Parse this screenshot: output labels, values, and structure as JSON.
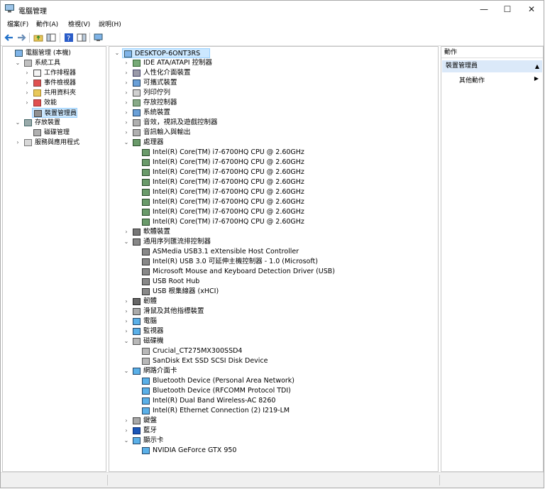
{
  "window": {
    "title": "電腦管理",
    "min": "—",
    "max": "☐",
    "close": "✕"
  },
  "menu": [
    "檔案(F)",
    "動作(A)",
    "檢視(V)",
    "說明(H)"
  ],
  "colors": {
    "selection": "#cce8ff",
    "action_section": "#dbe9f9"
  },
  "left_tree": [
    {
      "label": "電腦管理 (本機)",
      "level": 0,
      "expander": "",
      "icon": "computer-manage-icon"
    },
    {
      "label": "系統工具",
      "level": 1,
      "expander": "v",
      "icon": "tools-icon"
    },
    {
      "label": "工作排程器",
      "level": 2,
      "expander": ">",
      "icon": "clock-icon"
    },
    {
      "label": "事件檢視器",
      "level": 2,
      "expander": ">",
      "icon": "event-viewer-icon"
    },
    {
      "label": "共用資料夾",
      "level": 2,
      "expander": ">",
      "icon": "shared-folder-icon"
    },
    {
      "label": "效能",
      "level": 2,
      "expander": ">",
      "icon": "performance-icon"
    },
    {
      "label": "裝置管理員",
      "level": 2,
      "expander": "",
      "icon": "device-manager-icon",
      "selected": true
    },
    {
      "label": "存放裝置",
      "level": 1,
      "expander": "v",
      "icon": "storage-icon"
    },
    {
      "label": "磁碟管理",
      "level": 2,
      "expander": "",
      "icon": "disk-manage-icon"
    },
    {
      "label": "服務與應用程式",
      "level": 1,
      "expander": ">",
      "icon": "services-icon"
    }
  ],
  "device_tree": [
    {
      "label": "DESKTOP-6ONT3RS",
      "level": 0,
      "expander": "v",
      "icon": "computer-icon",
      "selected": true
    },
    {
      "label": "IDE ATA/ATAPI 控制器",
      "level": 1,
      "expander": ">",
      "icon": "ide-icon"
    },
    {
      "label": "人性化介面裝置",
      "level": 1,
      "expander": ">",
      "icon": "hid-icon"
    },
    {
      "label": "可攜式裝置",
      "level": 1,
      "expander": ">",
      "icon": "portable-icon"
    },
    {
      "label": "列印佇列",
      "level": 1,
      "expander": ">",
      "icon": "printer-icon"
    },
    {
      "label": "存放控制器",
      "level": 1,
      "expander": ">",
      "icon": "storage-controller-icon"
    },
    {
      "label": "系統裝置",
      "level": 1,
      "expander": ">",
      "icon": "system-device-icon"
    },
    {
      "label": "音效，視訊及遊戲控制器",
      "level": 1,
      "expander": ">",
      "icon": "sound-icon"
    },
    {
      "label": "音訊輸入與輸出",
      "level": 1,
      "expander": ">",
      "icon": "audio-io-icon"
    },
    {
      "label": "處理器",
      "level": 1,
      "expander": "v",
      "icon": "processor-icon"
    },
    {
      "label": "Intel(R) Core(TM) i7-6700HQ CPU @ 2.60GHz",
      "level": 2,
      "expander": "",
      "icon": "processor-icon"
    },
    {
      "label": "Intel(R) Core(TM) i7-6700HQ CPU @ 2.60GHz",
      "level": 2,
      "expander": "",
      "icon": "processor-icon"
    },
    {
      "label": "Intel(R) Core(TM) i7-6700HQ CPU @ 2.60GHz",
      "level": 2,
      "expander": "",
      "icon": "processor-icon"
    },
    {
      "label": "Intel(R) Core(TM) i7-6700HQ CPU @ 2.60GHz",
      "level": 2,
      "expander": "",
      "icon": "processor-icon"
    },
    {
      "label": "Intel(R) Core(TM) i7-6700HQ CPU @ 2.60GHz",
      "level": 2,
      "expander": "",
      "icon": "processor-icon"
    },
    {
      "label": "Intel(R) Core(TM) i7-6700HQ CPU @ 2.60GHz",
      "level": 2,
      "expander": "",
      "icon": "processor-icon"
    },
    {
      "label": "Intel(R) Core(TM) i7-6700HQ CPU @ 2.60GHz",
      "level": 2,
      "expander": "",
      "icon": "processor-icon"
    },
    {
      "label": "Intel(R) Core(TM) i7-6700HQ CPU @ 2.60GHz",
      "level": 2,
      "expander": "",
      "icon": "processor-icon"
    },
    {
      "label": "軟體裝置",
      "level": 1,
      "expander": ">",
      "icon": "software-device-icon"
    },
    {
      "label": "通用序列匯流排控制器",
      "level": 1,
      "expander": "v",
      "icon": "usb-icon"
    },
    {
      "label": "ASMedia USB3.1 eXtensible Host Controller",
      "level": 2,
      "expander": "",
      "icon": "usb-icon"
    },
    {
      "label": "Intel(R) USB 3.0 可延伸主機控制器 - 1.0 (Microsoft)",
      "level": 2,
      "expander": "",
      "icon": "usb-icon"
    },
    {
      "label": "Microsoft Mouse and Keyboard Detection Driver (USB)",
      "level": 2,
      "expander": "",
      "icon": "usb-icon"
    },
    {
      "label": "USB Root Hub",
      "level": 2,
      "expander": "",
      "icon": "usb-icon"
    },
    {
      "label": "USB 根集線器 (xHCI)",
      "level": 2,
      "expander": "",
      "icon": "usb-icon"
    },
    {
      "label": "韌體",
      "level": 1,
      "expander": ">",
      "icon": "firmware-icon"
    },
    {
      "label": "滑鼠及其他指標裝置",
      "level": 1,
      "expander": ">",
      "icon": "mouse-icon"
    },
    {
      "label": "電腦",
      "level": 1,
      "expander": ">",
      "icon": "monitor-icon"
    },
    {
      "label": "監視器",
      "level": 1,
      "expander": ">",
      "icon": "monitor-icon"
    },
    {
      "label": "磁碟機",
      "level": 1,
      "expander": "v",
      "icon": "disk-drive-icon"
    },
    {
      "label": "Crucial_CT275MX300SSD4",
      "level": 2,
      "expander": "",
      "icon": "disk-drive-icon"
    },
    {
      "label": "SanDisk Ext SSD SCSI Disk Device",
      "level": 2,
      "expander": "",
      "icon": "disk-drive-icon"
    },
    {
      "label": "網路介面卡",
      "level": 1,
      "expander": "v",
      "icon": "network-adapter-icon"
    },
    {
      "label": "Bluetooth Device (Personal Area Network)",
      "level": 2,
      "expander": "",
      "icon": "network-adapter-icon"
    },
    {
      "label": "Bluetooth Device (RFCOMM Protocol TDI)",
      "level": 2,
      "expander": "",
      "icon": "network-adapter-icon"
    },
    {
      "label": "Intel(R) Dual Band Wireless-AC 8260",
      "level": 2,
      "expander": "",
      "icon": "network-adapter-icon"
    },
    {
      "label": "Intel(R) Ethernet Connection (2) I219-LM",
      "level": 2,
      "expander": "",
      "icon": "network-adapter-icon"
    },
    {
      "label": "鍵盤",
      "level": 1,
      "expander": ">",
      "icon": "keyboard-icon"
    },
    {
      "label": "藍牙",
      "level": 1,
      "expander": ">",
      "icon": "bluetooth-icon"
    },
    {
      "label": "顯示卡",
      "level": 1,
      "expander": "v",
      "icon": "display-adapter-icon"
    },
    {
      "label": "NVIDIA GeForce GTX 950",
      "level": 2,
      "expander": "",
      "icon": "display-adapter-icon"
    }
  ],
  "actions": {
    "header": "動作",
    "section": "裝置管理員",
    "section_arrow": "▲",
    "item": "其他動作",
    "item_arrow": "▶"
  }
}
